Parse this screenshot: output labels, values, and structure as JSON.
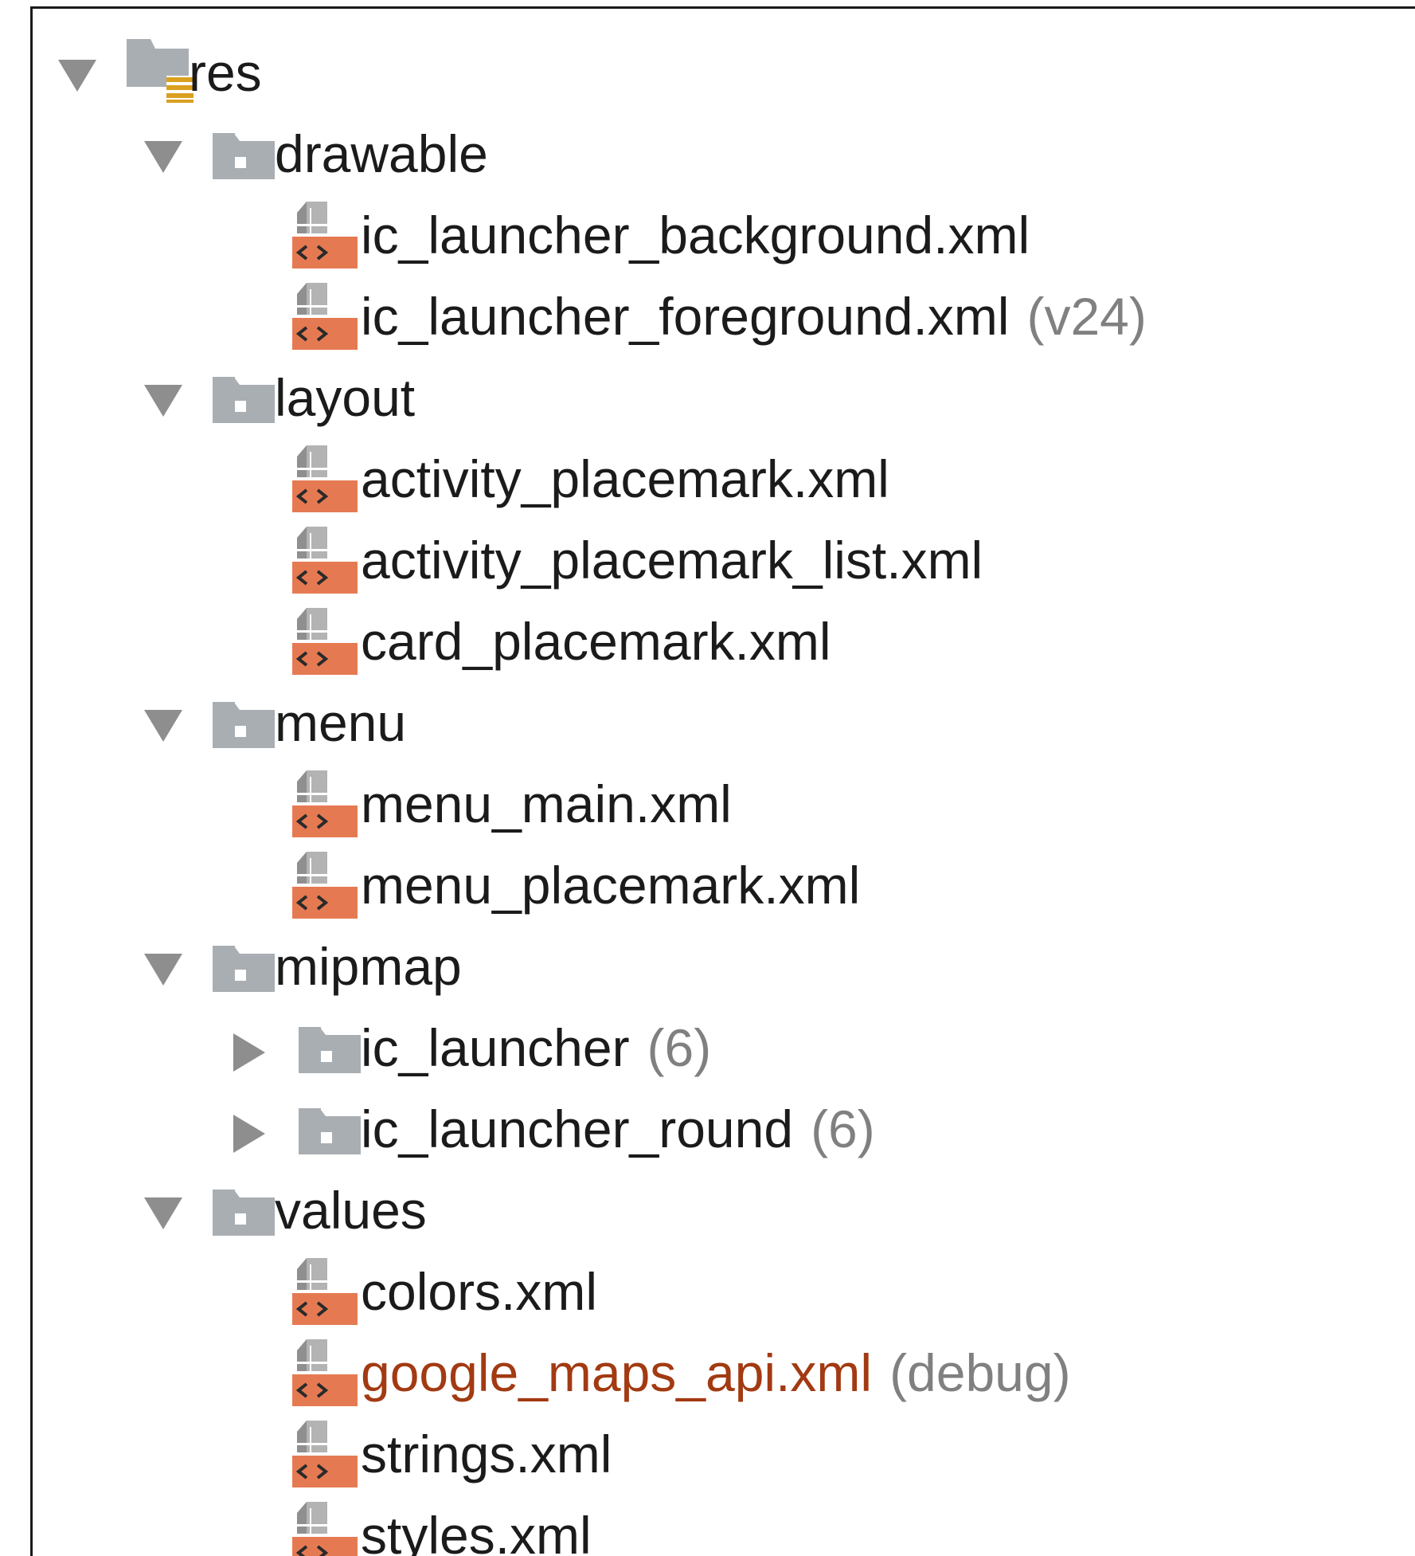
{
  "tree": {
    "nodes": [
      {
        "id": "res",
        "depth": 0,
        "kind": "res-folder",
        "expanded": true,
        "label": "res",
        "suffix": ""
      },
      {
        "id": "drawable",
        "depth": 1,
        "kind": "folder",
        "expanded": true,
        "label": "drawable",
        "suffix": ""
      },
      {
        "id": "ic_launcher_background",
        "depth": 2,
        "kind": "xml-file",
        "label": "ic_launcher_background.xml",
        "suffix": ""
      },
      {
        "id": "ic_launcher_foreground",
        "depth": 2,
        "kind": "xml-file",
        "label": "ic_launcher_foreground.xml",
        "suffix": "(v24)"
      },
      {
        "id": "layout",
        "depth": 1,
        "kind": "folder",
        "expanded": true,
        "label": "layout",
        "suffix": ""
      },
      {
        "id": "activity_placemark",
        "depth": 2,
        "kind": "xml-file",
        "label": "activity_placemark.xml",
        "suffix": ""
      },
      {
        "id": "activity_placemark_list",
        "depth": 2,
        "kind": "xml-file",
        "label": "activity_placemark_list.xml",
        "suffix": ""
      },
      {
        "id": "card_placemark",
        "depth": 2,
        "kind": "xml-file",
        "label": "card_placemark.xml",
        "suffix": ""
      },
      {
        "id": "menu",
        "depth": 1,
        "kind": "folder",
        "expanded": true,
        "label": "menu",
        "suffix": ""
      },
      {
        "id": "menu_main",
        "depth": 2,
        "kind": "xml-file",
        "label": "menu_main.xml",
        "suffix": ""
      },
      {
        "id": "menu_placemark",
        "depth": 2,
        "kind": "xml-file",
        "label": "menu_placemark.xml",
        "suffix": ""
      },
      {
        "id": "mipmap",
        "depth": 1,
        "kind": "folder",
        "expanded": true,
        "label": "mipmap",
        "suffix": ""
      },
      {
        "id": "ic_launcher",
        "depth": 2,
        "kind": "folder",
        "expanded": false,
        "label": "ic_launcher",
        "suffix": "(6)"
      },
      {
        "id": "ic_launcher_round",
        "depth": 2,
        "kind": "folder",
        "expanded": false,
        "label": "ic_launcher_round",
        "suffix": "(6)"
      },
      {
        "id": "values",
        "depth": 1,
        "kind": "folder",
        "expanded": true,
        "label": "values",
        "suffix": ""
      },
      {
        "id": "colors",
        "depth": 2,
        "kind": "xml-file",
        "label": "colors.xml",
        "suffix": ""
      },
      {
        "id": "google_maps_api",
        "depth": 2,
        "kind": "xml-file",
        "label": "google_maps_api.xml",
        "suffix": "(debug)",
        "label_color": "#a23a12"
      },
      {
        "id": "strings",
        "depth": 2,
        "kind": "xml-file",
        "label": "strings.xml",
        "suffix": ""
      },
      {
        "id": "styles",
        "depth": 2,
        "kind": "xml-file",
        "label": "styles.xml",
        "suffix": ""
      }
    ]
  },
  "icons": {
    "res-folder": "resource-folder-icon",
    "folder": "folder-icon",
    "xml-file": "xml-file-icon",
    "expanded": "chevron-down-icon",
    "collapsed": "chevron-right-icon"
  },
  "colors": {
    "folder_gray": "#a9aeb3",
    "xml_orange": "#e57a52",
    "arrow_gray": "#8e8e8e",
    "suffix_gray": "#808080",
    "modified_label": "#a23a12",
    "res_lines": "#d9a020"
  }
}
